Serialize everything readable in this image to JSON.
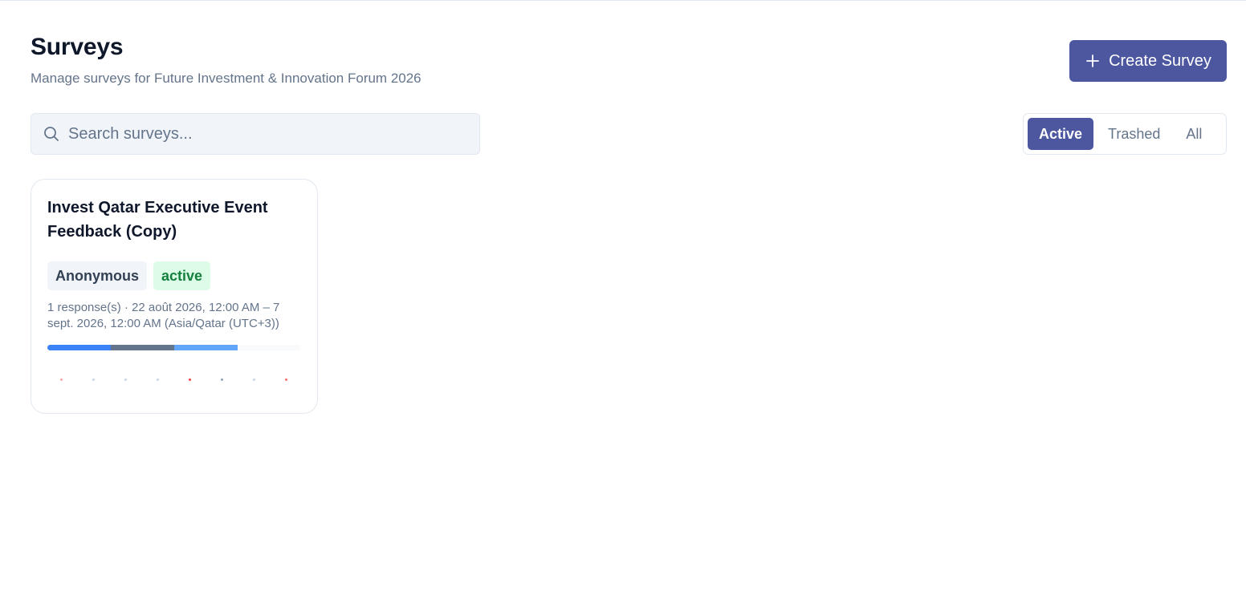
{
  "header": {
    "title": "Surveys",
    "subtitle": "Manage surveys for Future Investment & Innovation Forum 2026",
    "create_button_label": "Create Survey"
  },
  "search": {
    "placeholder": "Search surveys...",
    "value": ""
  },
  "filters": {
    "tabs": [
      "Active",
      "Trashed",
      "All"
    ],
    "selected": "Active"
  },
  "colors": {
    "accent": "#4c57a0",
    "status_active_bg": "#dcfce7",
    "status_active_text": "#15803d"
  },
  "surveys": [
    {
      "title": "Invest Qatar Executive Event Feedback (Copy)",
      "badge_type": "Anonymous",
      "badge_status": "active",
      "meta": "1 response(s) · 22 août 2026, 12:00 AM – 7 sept. 2026, 12:00 AM (Asia/Qatar (UTC+3))",
      "progress_segments": [
        {
          "fraction": 0.25,
          "color": "#3b82f6"
        },
        {
          "fraction": 0.25,
          "color": "#64748b"
        },
        {
          "fraction": 0.25,
          "color": "#60a5fa"
        }
      ],
      "dot_colors": [
        "#fca5a5",
        "#cbd5e1",
        "#cbd5e1",
        "#cbd5e1",
        "#ef4444",
        "#94a3b8",
        "#cbd5e1",
        "#f87171"
      ]
    }
  ]
}
